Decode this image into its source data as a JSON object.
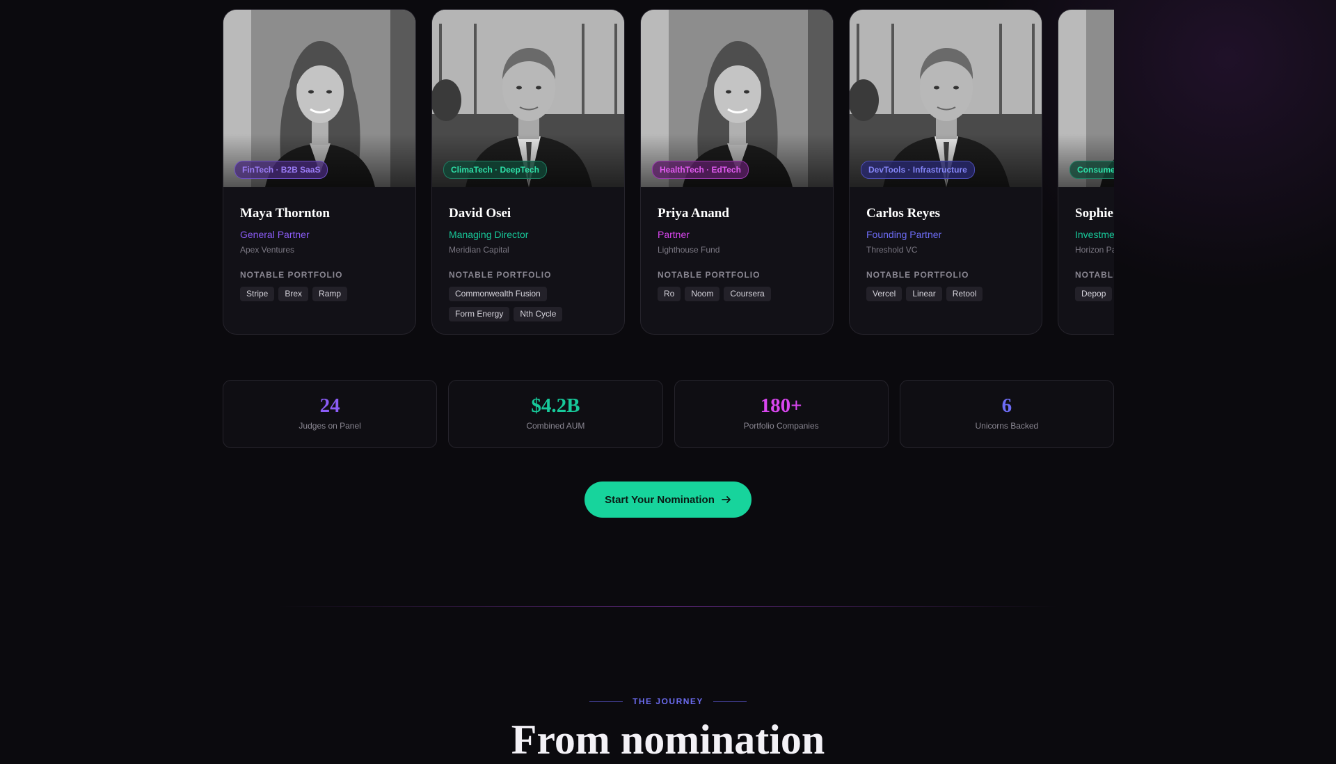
{
  "judges": [
    {
      "name": "Maya Thornton",
      "role": "General Partner",
      "firm": "Apex Ventures",
      "tag": "FinTech · B2B SaaS",
      "portfolio_label": "NOTABLE PORTFOLIO",
      "portfolio": [
        "Stripe",
        "Brex",
        "Ramp"
      ],
      "role_color": "#8b5cf6",
      "tag_color": "#9b7cf5",
      "tag_bg": "rgba(70,40,120,0.75)",
      "tag_border": "#6d4fc2",
      "photo": "woman"
    },
    {
      "name": "David Osei",
      "role": "Managing Director",
      "firm": "Meridian Capital",
      "tag": "ClimaTech · DeepTech",
      "portfolio_label": "NOTABLE PORTFOLIO",
      "portfolio": [
        "Commonwealth Fusion",
        "Form Energy",
        "Nth Cycle"
      ],
      "role_color": "#17c99a",
      "tag_color": "#2ee0a8",
      "tag_bg": "rgba(16,70,54,0.8)",
      "tag_border": "#1f7d62",
      "photo": "man"
    },
    {
      "name": "Priya Anand",
      "role": "Partner",
      "firm": "Lighthouse Fund",
      "tag": "HealthTech · EdTech",
      "portfolio_label": "NOTABLE PORTFOLIO",
      "portfolio": [
        "Ro",
        "Noom",
        "Coursera"
      ],
      "role_color": "#d946ef",
      "tag_color": "#e15bf0",
      "tag_bg": "rgba(90,30,100,0.8)",
      "tag_border": "#9a3aad",
      "photo": "woman"
    },
    {
      "name": "Carlos Reyes",
      "role": "Founding Partner",
      "firm": "Threshold VC",
      "tag": "DevTools · Infrastructure",
      "portfolio_label": "NOTABLE PORTFOLIO",
      "portfolio": [
        "Vercel",
        "Linear",
        "Retool"
      ],
      "role_color": "#6d6cf5",
      "tag_color": "#8586f7",
      "tag_bg": "rgba(40,40,110,0.8)",
      "tag_border": "#4d4eb5",
      "photo": "man"
    },
    {
      "name": "Sophie",
      "role": "Investme",
      "firm": "Horizon Pa",
      "tag": "Consume",
      "portfolio_label": "NOTABLI",
      "portfolio": [
        "Depop"
      ],
      "role_color": "#17c99a",
      "tag_color": "#2ee0a8",
      "tag_bg": "rgba(16,70,54,0.8)",
      "tag_border": "#1f7d62",
      "photo": "woman"
    }
  ],
  "stats": [
    {
      "value": "24",
      "label": "Judges on Panel",
      "color": "#8b5cf6"
    },
    {
      "value": "$4.2B",
      "label": "Combined AUM",
      "color": "#17c99a"
    },
    {
      "value": "180+",
      "label": "Portfolio Companies",
      "color": "#d946ef"
    },
    {
      "value": "6",
      "label": "Unicorns Backed",
      "color": "#6d6cf5"
    }
  ],
  "cta": {
    "label": "Start Your Nomination",
    "icon": "arrow-right-icon"
  },
  "journey": {
    "eyebrow": "THE JOURNEY",
    "title": "From nomination"
  }
}
